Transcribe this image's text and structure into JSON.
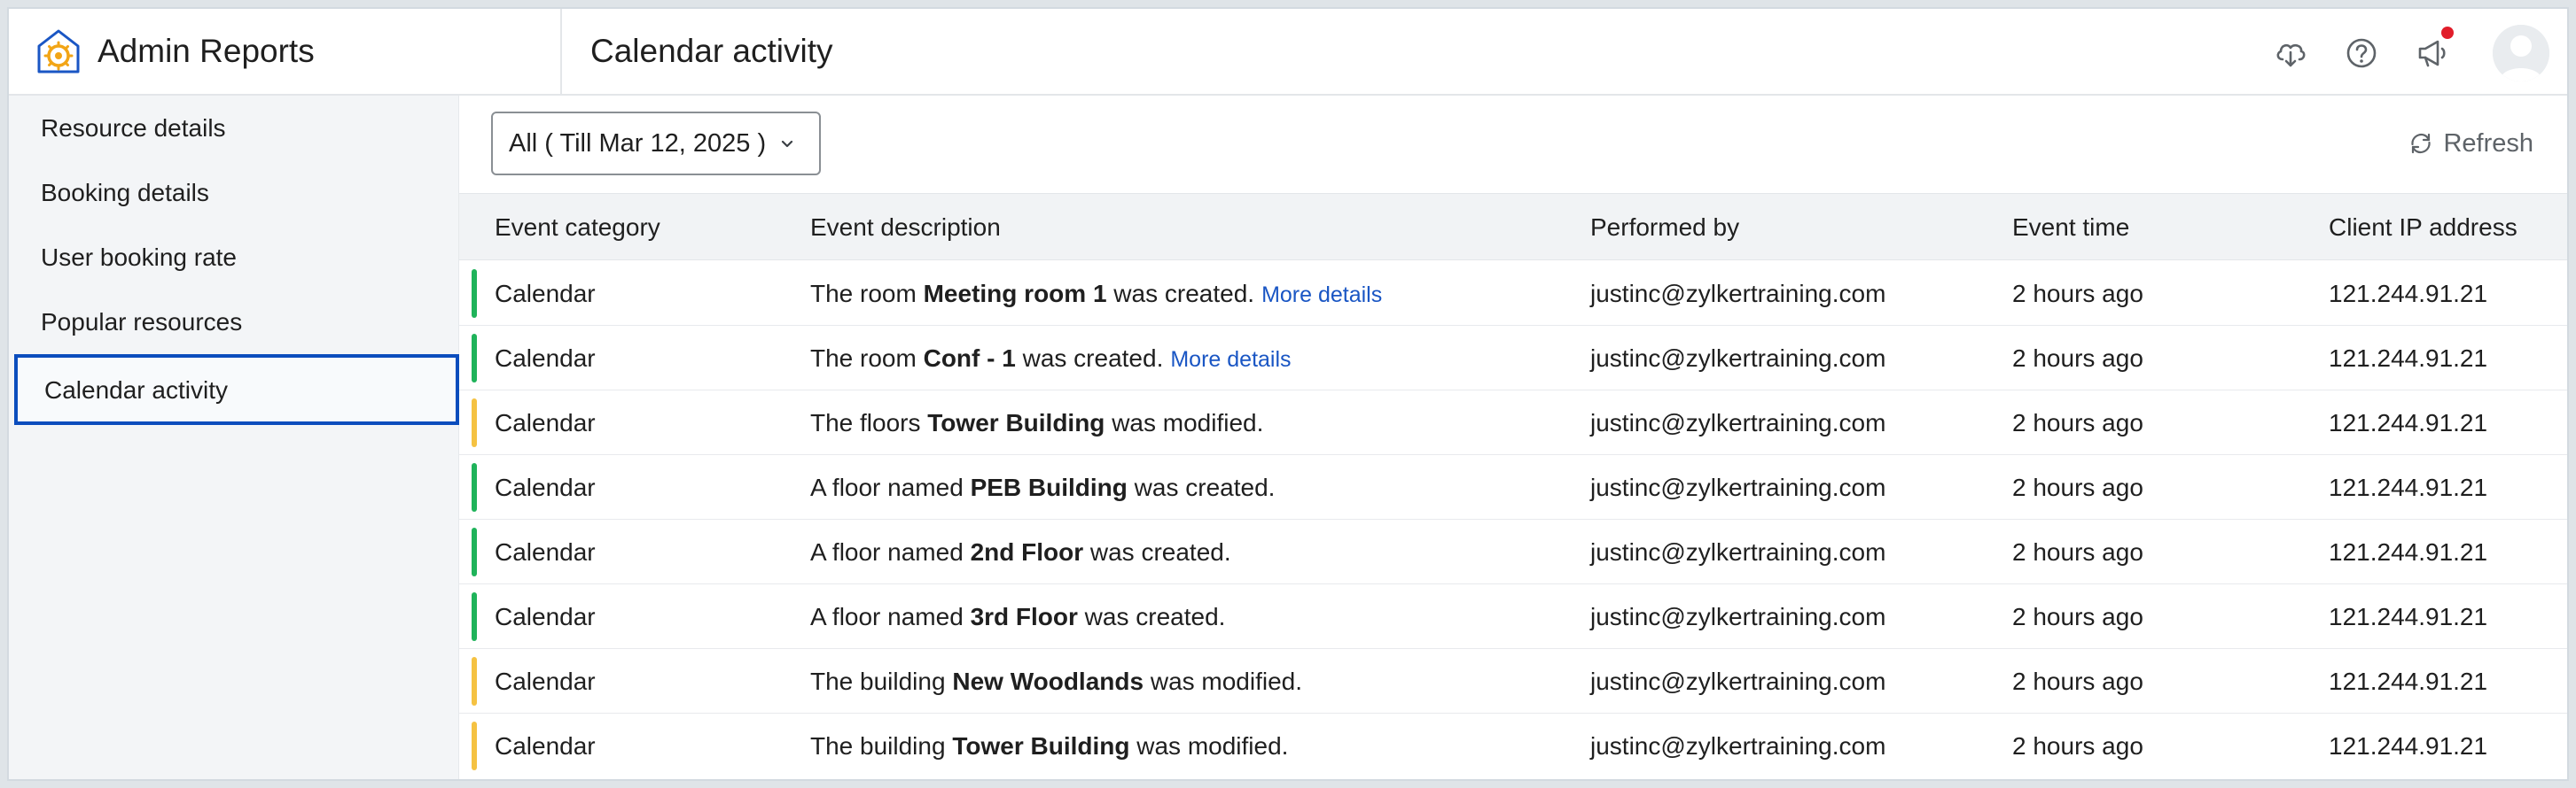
{
  "app": {
    "title": "Admin Reports"
  },
  "header": {
    "page_title": "Calendar activity",
    "icons": [
      "cloud-download-icon",
      "help-icon",
      "announcement-icon",
      "avatar"
    ],
    "notification_color": "#e11d2a"
  },
  "sidebar": {
    "items": [
      {
        "label": "Resource details",
        "active": false
      },
      {
        "label": "Booking details",
        "active": false
      },
      {
        "label": "User booking rate",
        "active": false
      },
      {
        "label": "Popular resources",
        "active": false
      },
      {
        "label": "Calendar activity",
        "active": true
      }
    ],
    "active_border_color": "#0b4dbd"
  },
  "toolbar": {
    "filter_label": "All ( Till Mar 12, 2025 )",
    "refresh_label": "Refresh"
  },
  "table": {
    "columns": [
      "Event category",
      "Event description",
      "Performed by",
      "Event time",
      "Client IP address"
    ],
    "status_colors": {
      "created": "#1fb35a",
      "modified": "#f5c242"
    },
    "rows": [
      {
        "category": "Calendar",
        "desc_pre": "The room ",
        "desc_bold": "Meeting room 1",
        "desc_post": " was created.",
        "more": "More details",
        "performed_by": "justinc@zylkertraining.com",
        "time": "2 hours ago",
        "ip": "121.244.91.21",
        "status": "created"
      },
      {
        "category": "Calendar",
        "desc_pre": "The room ",
        "desc_bold": "Conf - 1",
        "desc_post": " was created.",
        "more": "More details",
        "performed_by": "justinc@zylkertraining.com",
        "time": "2 hours ago",
        "ip": "121.244.91.21",
        "status": "created"
      },
      {
        "category": "Calendar",
        "desc_pre": "The floors ",
        "desc_bold": "Tower Building",
        "desc_post": " was modified.",
        "more": "",
        "performed_by": "justinc@zylkertraining.com",
        "time": "2 hours ago",
        "ip": "121.244.91.21",
        "status": "modified"
      },
      {
        "category": "Calendar",
        "desc_pre": "A floor named ",
        "desc_bold": "PEB Building",
        "desc_post": " was created.",
        "more": "",
        "performed_by": "justinc@zylkertraining.com",
        "time": "2 hours ago",
        "ip": "121.244.91.21",
        "status": "created"
      },
      {
        "category": "Calendar",
        "desc_pre": "A floor named ",
        "desc_bold": "2nd Floor",
        "desc_post": " was created.",
        "more": "",
        "performed_by": "justinc@zylkertraining.com",
        "time": "2 hours ago",
        "ip": "121.244.91.21",
        "status": "created"
      },
      {
        "category": "Calendar",
        "desc_pre": "A floor named ",
        "desc_bold": "3rd Floor",
        "desc_post": " was created.",
        "more": "",
        "performed_by": "justinc@zylkertraining.com",
        "time": "2 hours ago",
        "ip": "121.244.91.21",
        "status": "created"
      },
      {
        "category": "Calendar",
        "desc_pre": "The building ",
        "desc_bold": "New Woodlands",
        "desc_post": " was modified.",
        "more": "",
        "performed_by": "justinc@zylkertraining.com",
        "time": "2 hours ago",
        "ip": "121.244.91.21",
        "status": "modified"
      },
      {
        "category": "Calendar",
        "desc_pre": "The building ",
        "desc_bold": "Tower Building",
        "desc_post": " was modified.",
        "more": "",
        "performed_by": "justinc@zylkertraining.com",
        "time": "2 hours ago",
        "ip": "121.244.91.21",
        "status": "modified"
      }
    ]
  }
}
